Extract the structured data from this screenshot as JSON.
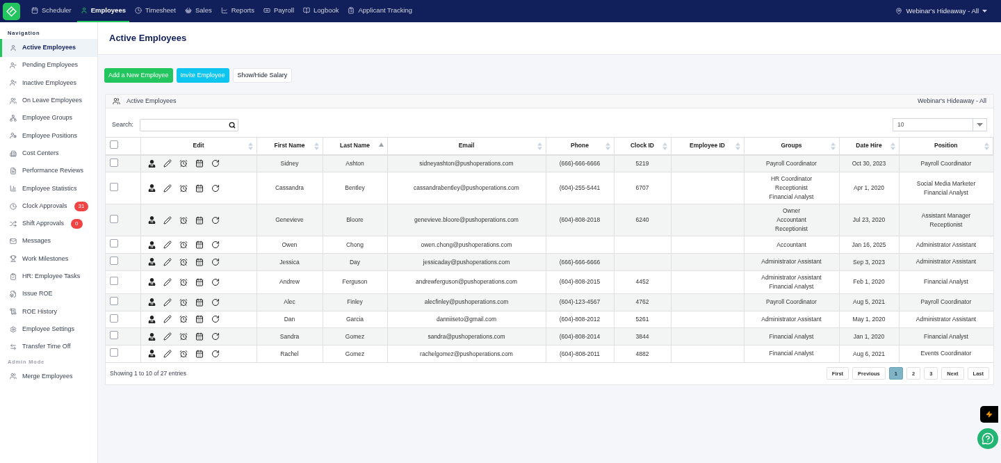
{
  "topnav": {
    "items": [
      {
        "label": "Scheduler",
        "selected": false
      },
      {
        "label": "Employees",
        "selected": true
      },
      {
        "label": "Timesheet",
        "selected": false
      },
      {
        "label": "Sales",
        "selected": false
      },
      {
        "label": "Reports",
        "selected": false
      },
      {
        "label": "Payroll",
        "selected": false
      },
      {
        "label": "Logbook",
        "selected": false
      },
      {
        "label": "Applicant Tracking",
        "selected": false
      }
    ],
    "location": "Webinar's Hideaway - All"
  },
  "sidebar": {
    "sections": [
      {
        "heading": "Navigation",
        "items": [
          {
            "label": "Active Employees",
            "selected": true
          },
          {
            "label": "Pending Employees",
            "selected": false
          },
          {
            "label": "Inactive Employees",
            "selected": false
          },
          {
            "label": "On Leave Employees",
            "selected": false
          },
          {
            "label": "Employee Groups",
            "selected": false
          },
          {
            "label": "Employee Positions",
            "selected": false
          },
          {
            "label": "Cost Centers",
            "selected": false
          },
          {
            "label": "Performance Reviews",
            "selected": false
          },
          {
            "label": "Employee Statistics",
            "selected": false
          },
          {
            "label": "Clock Approvals",
            "selected": false,
            "badge": "31"
          },
          {
            "label": "Shift Approvals",
            "selected": false,
            "badge": "0"
          },
          {
            "label": "Messages",
            "selected": false
          },
          {
            "label": "Work Milestones",
            "selected": false
          },
          {
            "label": "HR: Employee Tasks",
            "selected": false
          },
          {
            "label": "Issue ROE",
            "selected": false
          },
          {
            "label": "ROE History",
            "selected": false
          },
          {
            "label": "Employee Settings",
            "selected": false
          },
          {
            "label": "Transfer Time Off",
            "selected": false
          }
        ]
      },
      {
        "heading": "Admin Mode",
        "items": [
          {
            "label": "Merge Employees",
            "selected": false
          }
        ]
      }
    ]
  },
  "page_title": "Active Employees",
  "actions": [
    "Add a New Employee",
    "Invite Employee",
    "Show/Hide Salary"
  ],
  "panel": {
    "title": "Active Employees",
    "location": "Webinar's Hideaway - All",
    "search_label": "Search:",
    "page_size": "10",
    "header_checked": false,
    "columns": [
      {
        "label": "Edit",
        "sorted": false
      },
      {
        "label": "First Name",
        "sorted": false
      },
      {
        "label": "Last Name",
        "sorted": true
      },
      {
        "label": "Email",
        "sorted": false
      },
      {
        "label": "Phone",
        "sorted": false
      },
      {
        "label": "Clock ID",
        "sorted": false
      },
      {
        "label": "Employee ID",
        "sorted": false
      },
      {
        "label": "Groups",
        "sorted": false
      },
      {
        "label": "Date Hire",
        "sorted": false
      },
      {
        "label": "Position",
        "sorted": false
      }
    ],
    "rows": [
      {
        "checked": false,
        "first": "Sidney",
        "last": "Ashton",
        "email": "sidneyashton@pushoperations.com",
        "phone": "(666)-666-6666",
        "clock_id": "5219",
        "groups": [
          "Payroll Coordinator"
        ],
        "date_hire": "Oct 30, 2023",
        "positions": [
          "Payroll Coordinator"
        ]
      },
      {
        "checked": false,
        "first": "Cassandra",
        "last": "Bentley",
        "email": "cassandrabentley@pushoperations.com",
        "phone": "(604)-255-5441",
        "clock_id": "6707",
        "groups": [
          "HR Coordinator",
          "Receptionist",
          "Financial Analyst"
        ],
        "date_hire": "Apr 1, 2020",
        "positions": [
          "Social Media Marketer",
          "Financial Analyst"
        ]
      },
      {
        "checked": false,
        "first": "Genevieve",
        "last": "Bloore",
        "email": "genevieve.bloore@pushoperations.com",
        "phone": "(604)-808-2018",
        "clock_id": "6240",
        "groups": [
          "Owner",
          "Accountant",
          "Receptionist"
        ],
        "date_hire": "Jul 23, 2020",
        "positions": [
          "Assistant Manager",
          "Receptionist"
        ]
      },
      {
        "checked": false,
        "first": "Owen",
        "last": "Chong",
        "email": "owen.chong@pushoperations.com",
        "groups": [
          "Accountant"
        ],
        "date_hire": "Jan 16, 2025",
        "positions": [
          "Administrator Assistant"
        ]
      },
      {
        "checked": false,
        "first": "Jessica",
        "last": "Day",
        "email": "jessicaday@pushoperations.com",
        "phone": "(666)-666-6666",
        "groups": [
          "Administrator Assistant"
        ],
        "date_hire": "Sep 3, 2023",
        "positions": [
          "Administrator Assistant"
        ]
      },
      {
        "checked": false,
        "first": "Andrew",
        "last": "Ferguson",
        "email": "andrewferguson@pushoperations.com",
        "phone": "(604)-808-2015",
        "clock_id": "4452",
        "groups": [
          "Administrator Assistant",
          "Financial Analyst"
        ],
        "date_hire": "Feb 1, 2020",
        "positions": [
          "Financial Analyst"
        ]
      },
      {
        "checked": false,
        "first": "Alec",
        "last": "Finley",
        "email": "alecfinley@pushoperations.com",
        "phone": "(604)-123-4567",
        "clock_id": "4762",
        "groups": [
          "Payroll Coordinator"
        ],
        "date_hire": "Aug 5, 2021",
        "positions": [
          "Payroll Coordinator"
        ]
      },
      {
        "checked": false,
        "first": "Dan",
        "last": "Garcia",
        "email": "danniiseto@gmail.com",
        "phone": "(604)-808-2012",
        "clock_id": "5261",
        "groups": [
          "Administrator Assistant"
        ],
        "date_hire": "May 1, 2020",
        "positions": [
          "Administrator Assistant"
        ]
      },
      {
        "checked": false,
        "first": "Sandra",
        "last": "Gomez",
        "email": "sandra@pushoperations.com",
        "phone": "(604)-808-2014",
        "clock_id": "3844",
        "groups": [
          "Financial Analyst"
        ],
        "date_hire": "Jan 1, 2020",
        "positions": [
          "Financial Analyst"
        ]
      },
      {
        "checked": false,
        "first": "Rachel",
        "last": "Gomez",
        "email": "rachelgomez@pushoperations.com",
        "phone": "(604)-808-2011",
        "clock_id": "4882",
        "groups": [
          "Financial Analyst"
        ],
        "date_hire": "Aug 6, 2021",
        "positions": [
          "Events Coordinator"
        ]
      }
    ],
    "summary": "Showing 1 to 10 of 27 entries",
    "pagination": [
      {
        "label": "First",
        "selected": false
      },
      {
        "label": "Previous",
        "selected": false
      },
      {
        "label": "1",
        "selected": true
      },
      {
        "label": "2",
        "selected": false
      },
      {
        "label": "3",
        "selected": false
      },
      {
        "label": "Next",
        "selected": false
      },
      {
        "label": "Last",
        "selected": false
      }
    ]
  }
}
